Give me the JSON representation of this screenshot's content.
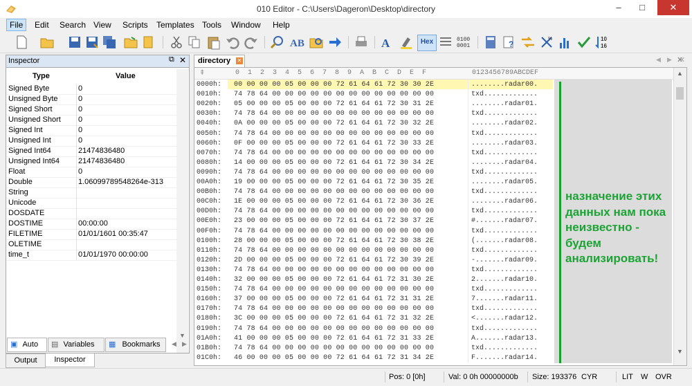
{
  "window": {
    "title": "010 Editor - C:\\Users\\Dageron\\Desktop\\directory",
    "min": "–",
    "max": "□",
    "close": "✕"
  },
  "menu": [
    "File",
    "Edit",
    "Search",
    "View",
    "Scripts",
    "Templates",
    "Tools",
    "Window",
    "Help"
  ],
  "toolbar": {
    "hex_label": "Hex"
  },
  "inspector": {
    "title": "Inspector",
    "col_type": "Type",
    "col_value": "Value",
    "rows": [
      [
        "Signed Byte",
        "0"
      ],
      [
        "Unsigned Byte",
        "0"
      ],
      [
        "Signed Short",
        "0"
      ],
      [
        "Unsigned Short",
        "0"
      ],
      [
        "Signed Int",
        "0"
      ],
      [
        "Unsigned Int",
        "0"
      ],
      [
        "Signed Int64",
        "21474836480"
      ],
      [
        "Unsigned Int64",
        "21474836480"
      ],
      [
        "Float",
        "0"
      ],
      [
        "Double",
        "1.06099789548264e-313"
      ],
      [
        "String",
        ""
      ],
      [
        "Unicode",
        ""
      ],
      [
        "DOSDATE",
        ""
      ],
      [
        "DOSTIME",
        "00:00:00"
      ],
      [
        "FILETIME",
        "01/01/1601 00:35:47"
      ],
      [
        "OLETIME",
        ""
      ],
      [
        "time_t",
        "01/01/1970 00:00:00"
      ]
    ],
    "tabs": [
      "Auto",
      "Variables",
      "Bookmarks"
    ],
    "bottom_tabs": [
      "Output",
      "Inspector"
    ]
  },
  "editor": {
    "tab_label": "directory",
    "col_header": "0  1  2  3  4  5  6  7  8  9  A  B  C  D  E  F",
    "ascii_header": "0123456789ABCDEF",
    "rows": [
      [
        "0000h:",
        "00 00 00 00 05 00 00 00 72 61 64 61 72 30 30 2E",
        "........radar00."
      ],
      [
        "0010h:",
        "74 78 64 00 00 00 00 00 00 00 00 00 00 00 00 00",
        "txd............."
      ],
      [
        "0020h:",
        "05 00 00 00 05 00 00 00 72 61 64 61 72 30 31 2E",
        "........radar01."
      ],
      [
        "0030h:",
        "74 78 64 00 00 00 00 00 00 00 00 00 00 00 00 00",
        "txd............."
      ],
      [
        "0040h:",
        "0A 00 00 00 05 00 00 00 72 61 64 61 72 30 32 2E",
        "........radar02."
      ],
      [
        "0050h:",
        "74 78 64 00 00 00 00 00 00 00 00 00 00 00 00 00",
        "txd............."
      ],
      [
        "0060h:",
        "0F 00 00 00 05 00 00 00 72 61 64 61 72 30 33 2E",
        "........radar03."
      ],
      [
        "0070h:",
        "74 78 64 00 00 00 00 00 00 00 00 00 00 00 00 00",
        "txd............."
      ],
      [
        "0080h:",
        "14 00 00 00 05 00 00 00 72 61 64 61 72 30 34 2E",
        "........radar04."
      ],
      [
        "0090h:",
        "74 78 64 00 00 00 00 00 00 00 00 00 00 00 00 00",
        "txd............."
      ],
      [
        "00A0h:",
        "19 00 00 00 05 00 00 00 72 61 64 61 72 30 35 2E",
        "........radar05."
      ],
      [
        "00B0h:",
        "74 78 64 00 00 00 00 00 00 00 00 00 00 00 00 00",
        "txd............."
      ],
      [
        "00C0h:",
        "1E 00 00 00 05 00 00 00 72 61 64 61 72 30 36 2E",
        "........radar06."
      ],
      [
        "00D0h:",
        "74 78 64 00 00 00 00 00 00 00 00 00 00 00 00 00",
        "txd............."
      ],
      [
        "00E0h:",
        "23 00 00 00 05 00 00 00 72 61 64 61 72 30 37 2E",
        "#.......radar07."
      ],
      [
        "00F0h:",
        "74 78 64 00 00 00 00 00 00 00 00 00 00 00 00 00",
        "txd............."
      ],
      [
        "0100h:",
        "28 00 00 00 05 00 00 00 72 61 64 61 72 30 38 2E",
        "(.......radar08."
      ],
      [
        "0110h:",
        "74 78 64 00 00 00 00 00 00 00 00 00 00 00 00 00",
        "txd............."
      ],
      [
        "0120h:",
        "2D 00 00 00 05 00 00 00 72 61 64 61 72 30 39 2E",
        "-.......radar09."
      ],
      [
        "0130h:",
        "74 78 64 00 00 00 00 00 00 00 00 00 00 00 00 00",
        "txd............."
      ],
      [
        "0140h:",
        "32 00 00 00 05 00 00 00 72 61 64 61 72 31 30 2E",
        "2.......radar10."
      ],
      [
        "0150h:",
        "74 78 64 00 00 00 00 00 00 00 00 00 00 00 00 00",
        "txd............."
      ],
      [
        "0160h:",
        "37 00 00 00 05 00 00 00 72 61 64 61 72 31 31 2E",
        "7.......radar11."
      ],
      [
        "0170h:",
        "74 78 64 00 00 00 00 00 00 00 00 00 00 00 00 00",
        "txd............."
      ],
      [
        "0180h:",
        "3C 00 00 00 05 00 00 00 72 61 64 61 72 31 32 2E",
        "<.......radar12."
      ],
      [
        "0190h:",
        "74 78 64 00 00 00 00 00 00 00 00 00 00 00 00 00",
        "txd............."
      ],
      [
        "01A0h:",
        "41 00 00 00 05 00 00 00 72 61 64 61 72 31 33 2E",
        "A.......radar13."
      ],
      [
        "01B0h:",
        "74 78 64 00 00 00 00 00 00 00 00 00 00 00 00 00",
        "txd............."
      ],
      [
        "01C0h:",
        "46 00 00 00 05 00 00 00 72 61 64 61 72 31 34 2E",
        "F.......radar14."
      ]
    ],
    "note": "назначение этих данных нам пока неизвестно - будем анализировать!"
  },
  "status": {
    "pos": "Pos: 0 [0h]",
    "val": "Val: 0 0h 00000000b",
    "size": "Size: 193376",
    "enc": "CYR",
    "lit": "LIT",
    "w": "W",
    "ovr": "OVR"
  },
  "colors": {
    "note_green": "#1da335",
    "selection_yellow": "#fff7b2",
    "close_red": "#c7372f"
  }
}
